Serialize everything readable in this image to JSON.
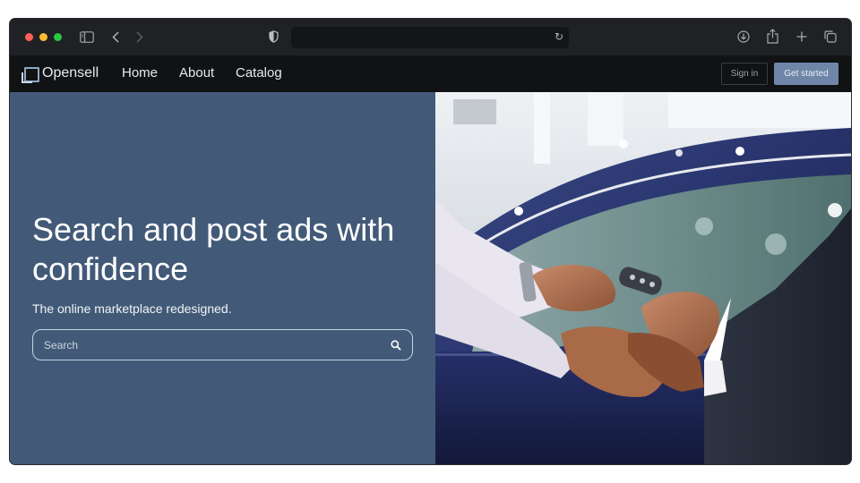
{
  "browser": {
    "icons": [
      "sidebar-icon",
      "back-icon",
      "forward-icon",
      "shield-icon",
      "reload-icon",
      "download-icon",
      "share-icon",
      "new-tab-icon",
      "tab-overview-icon"
    ],
    "address_value": ""
  },
  "nav": {
    "brand": "Opensell",
    "links": [
      "Home",
      "About",
      "Catalog"
    ],
    "sign_in": "Sign in",
    "get_started": "Get started"
  },
  "hero": {
    "title": "Search and post ads with confidence",
    "subtitle": "The online marketplace redesigned.",
    "search_placeholder": "Search",
    "background_color": "#425a78",
    "image_subject": "car-key-handover-handshake-photo"
  },
  "colors": {
    "accent": "#6f86a8",
    "nav_bg": "#111214",
    "chrome_bg": "#1f2125"
  }
}
